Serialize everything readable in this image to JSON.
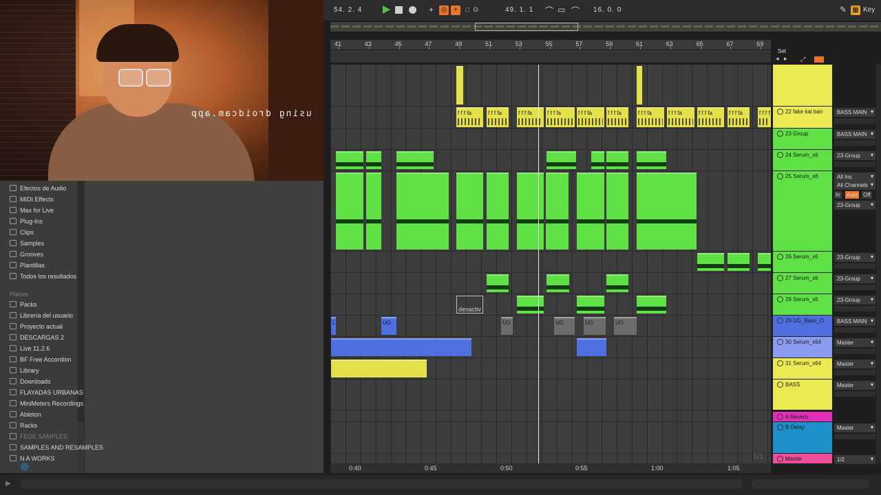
{
  "webcam": {
    "watermark": "using droidcam.app"
  },
  "browser": {
    "items": [
      {
        "label": "Efectos de Audio",
        "icon": "audio-effects-icon"
      },
      {
        "label": "MIDI Effects",
        "icon": "midi-effects-icon"
      },
      {
        "label": "Max for Live",
        "icon": "max-for-live-icon"
      },
      {
        "label": "Plug-Ins",
        "icon": "plugins-icon"
      },
      {
        "label": "Clips",
        "icon": "clips-icon"
      },
      {
        "label": "Samples",
        "icon": "samples-icon"
      },
      {
        "label": "Grooves",
        "icon": "grooves-icon"
      },
      {
        "label": "Plantillas",
        "icon": "templates-icon"
      },
      {
        "label": "Todos los resultados",
        "icon": "all-results-icon"
      }
    ],
    "places_header": "Places",
    "places": [
      {
        "label": "Packs"
      },
      {
        "label": "Librería del usuario"
      },
      {
        "label": "Proyecto actual"
      },
      {
        "label": "DESCARGAS 2"
      },
      {
        "label": "Live 11.2.6"
      },
      {
        "label": "BF Free Accordion"
      },
      {
        "label": "Library"
      },
      {
        "label": "Downloads"
      },
      {
        "label": "FLAYADAS URBANAS"
      },
      {
        "label": "MiniMeters Recordings"
      },
      {
        "label": "Ableton"
      },
      {
        "label": "Racks"
      },
      {
        "label": "FEDE SAMPLES"
      },
      {
        "label": "SAMPLES AND RESAMPLES"
      },
      {
        "label": "N A WORKS"
      }
    ]
  },
  "transport": {
    "position": "54.  2.  4",
    "loop_start": "49.  1.  1",
    "loop_length": "16.  0.  0",
    "key_label": "Key",
    "colors": {
      "play": "#4ec14e",
      "orange": "#e8762c"
    }
  },
  "arrangement": {
    "bars": [
      "41",
      "43",
      "45",
      "47",
      "49",
      "51",
      "53",
      "55",
      "57",
      "59",
      "61",
      "63",
      "65",
      "67",
      "69"
    ],
    "times": [
      "0:40",
      "0:45",
      "0:50",
      "0:55",
      "1:00",
      "1:05"
    ],
    "page_indicator": "1/1",
    "clip_labels": {
      "desactivado": "desactiv",
      "fake": "f f f fa",
      "ug": "UG"
    }
  },
  "mixer": {
    "set_label": "Set",
    "tracks": [
      {
        "name": "",
        "color": "#ecea52",
        "route": ""
      },
      {
        "name": "22 fake kal ban",
        "color": "#ecea52",
        "route": "BASS MAIN"
      },
      {
        "name": "23 Group",
        "color": "#5fe044",
        "route": "BASS MAIN"
      },
      {
        "name": "24 Serum_x6",
        "color": "#5fe044",
        "route": "23-Group"
      },
      {
        "name": "25 Serum_x6",
        "color": "#5fe044",
        "route": "All Ins",
        "route2": "All Channels",
        "monitor": [
          "In",
          "Auto",
          "Off"
        ],
        "route3": "23-Group"
      },
      {
        "name": "26 Serum_x6",
        "color": "#5fe044",
        "route": "23-Group"
      },
      {
        "name": "27 Serum_x6",
        "color": "#5fe044",
        "route": "23-Group"
      },
      {
        "name": "28 Serum_x6",
        "color": "#5fe044",
        "route": "23-Group"
      },
      {
        "name": "29 UG_Bass_O",
        "color": "#4e6fe0",
        "route": "BASS MAIN"
      },
      {
        "name": "30 Serum_x64",
        "color": "#8b9cf0",
        "route": "Master"
      },
      {
        "name": "31 Serum_x64",
        "color": "#ecea52",
        "route": "Master"
      },
      {
        "name": "BASS",
        "color": "#ecea52",
        "route": "Master"
      },
      {
        "name": "A Reverb",
        "color": "#e22fb8",
        "route": ""
      },
      {
        "name": "B Delay",
        "color": "#1e8fc8",
        "route": "Master"
      },
      {
        "name": "Master",
        "color": "#f04d9a",
        "route": "1/2"
      }
    ]
  }
}
